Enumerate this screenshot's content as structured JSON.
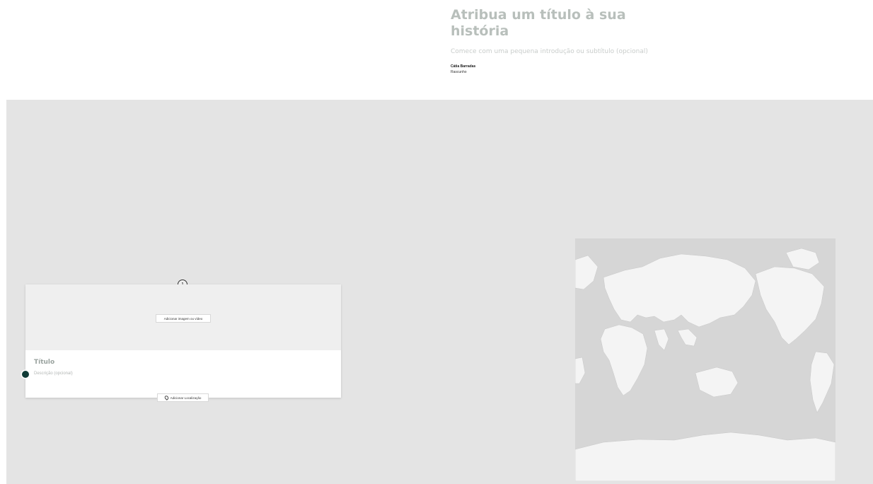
{
  "story": {
    "title": "Atribua um título à sua história",
    "subtitle": "Comece com uma pequena introdução ou subtítulo (opcional)",
    "author": "Cátia Barradas",
    "status": "Rascunho"
  },
  "step": {
    "number": "1",
    "media_button_label": "Adicionar imagem ou vídeo",
    "title_placeholder": "Título",
    "description_placeholder": "Descrição (opcional)",
    "location_button_label": "Adicionar Localização"
  },
  "icons": {
    "location": "map-pin-icon"
  },
  "colors": {
    "stage_background": "#e4e4e4",
    "map_ocean": "#d6d6d6",
    "map_land": "#f4f4f4",
    "timeline_dot": "#0f3b36",
    "title_text": "#b8bfbb"
  }
}
